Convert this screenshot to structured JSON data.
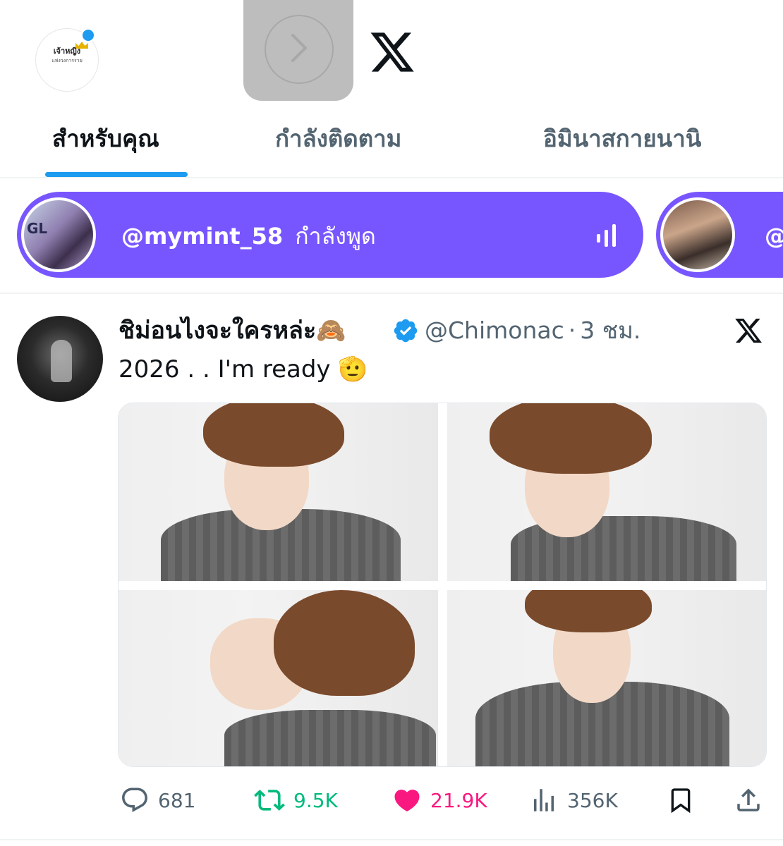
{
  "header": {
    "avatar_logo_text": "เจ้าหญิง",
    "avatar_logo_sub": "แห่งวงการราย"
  },
  "tabs": [
    {
      "label": "สำหรับคุณ",
      "active": true
    },
    {
      "label": "กำลังติดตาม",
      "active": false
    },
    {
      "label": "อิมินาสกายนานิ",
      "active": false
    }
  ],
  "spaces": [
    {
      "handle": "@mymint_58",
      "status": "กำลังพูด",
      "avatar_text": "GL"
    },
    {
      "handle": "@"
    }
  ],
  "tweet": {
    "name": "ชิม่อนไงจะใครหล่ะ🙈",
    "verified": true,
    "handle": "@Chimonac",
    "separator": "·",
    "time": "3 ชม.",
    "text": "2026 . . I'm ready 🫡",
    "actions": {
      "replies": "681",
      "reposts": "9.5K",
      "likes": "21.9K",
      "views": "356K"
    }
  },
  "colors": {
    "accent": "#1d9bf0",
    "spaces": "#7856ff",
    "repost": "#00ba7c",
    "like": "#f91880",
    "muted": "#536471"
  },
  "icons": [
    "x-logo-icon",
    "chevron-right-icon",
    "verified-badge-icon",
    "reply-icon",
    "repost-icon",
    "like-icon",
    "views-icon",
    "bookmark-icon",
    "share-icon",
    "audio-bars-icon"
  ]
}
